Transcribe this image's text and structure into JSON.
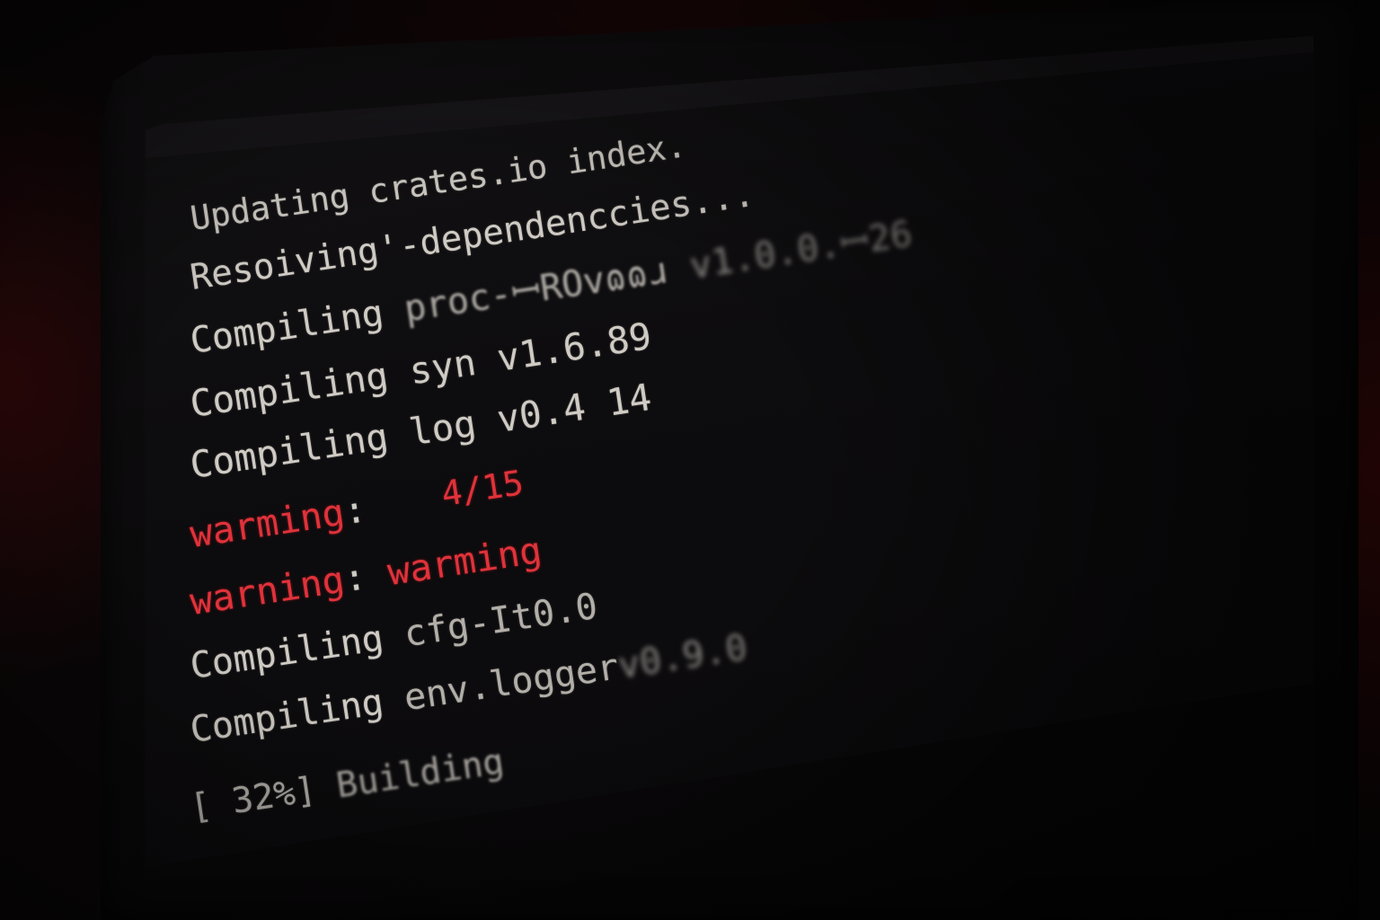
{
  "terminal": {
    "lines": {
      "updating": {
        "verb": "Updating",
        "text": "crates.io index."
      },
      "resolving": {
        "verb": "Resoiving'",
        "text": "-dependenccies..."
      },
      "compile_proc": {
        "verb": "Compiling",
        "crate": "proc-ꟷROvɷɷɹ",
        "version": "v1.0.0.ꟷ26"
      },
      "compile_syn": {
        "verb": "Compiling",
        "crate": "syn",
        "version": "v1.6.89"
      },
      "compile_log": {
        "verb": "Compiling",
        "crate": "log",
        "version": "v0.4 14"
      },
      "warning_one": {
        "label": "warming",
        "colon": ":"
      },
      "warning_two": {
        "label": "warning",
        "colon": ":",
        "text": "warming"
      },
      "compile_cfg": {
        "verb": "Compiling",
        "crate": "cfg-It0.0"
      },
      "compile_env": {
        "verb": "Compiling",
        "crate": "env.logger",
        "version": "v0.9.0"
      },
      "building": {
        "progress_text": "[ 32%]",
        "status": "Building"
      }
    },
    "counter": "4/15",
    "progress_percent": 32
  },
  "colors": {
    "text": "#cfcbc4",
    "warning": "#e0323a",
    "background": "#0d0c0e",
    "ambient": "#7a0a0c"
  }
}
